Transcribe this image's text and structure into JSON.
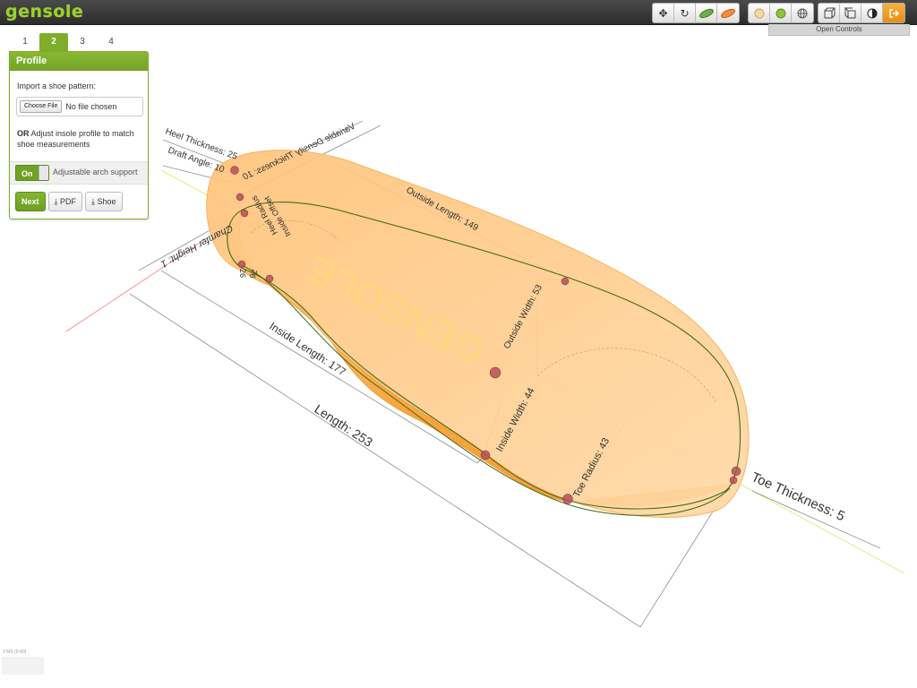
{
  "app": {
    "logo": "gensole"
  },
  "toolbar": {
    "groups": [
      {
        "name": "view-tools",
        "icons": [
          "move-icon",
          "rotate-icon",
          "insole-green-icon",
          "insole-orange-icon"
        ]
      },
      {
        "name": "material-tools",
        "icons": [
          "beige-sphere-icon",
          "green-sphere-icon",
          "wireframe-globe-icon"
        ]
      },
      {
        "name": "camera-tools",
        "icons": [
          "cube-front-icon",
          "cube-side-icon",
          "contrast-icon",
          "exit-icon"
        ]
      }
    ],
    "open_controls": "Open Controls"
  },
  "tabs": [
    "1",
    "2",
    "3",
    "4"
  ],
  "active_tab": "2",
  "panel": {
    "title": "Profile",
    "import_label": "Import a shoe pattern:",
    "file_button": "Choose File",
    "file_status": "No file chosen",
    "or_prefix": "OR",
    "adjust_text": "Adjust insole profile to match shoe measurements",
    "toggle_label": "On",
    "arch_support": "Adjustable arch support",
    "next": "Next",
    "pdf": "PDF",
    "shoe": "Shoe"
  },
  "status": "2 MS (0-60)",
  "insole_logo": "GENSOLE",
  "measurements": {
    "heel_thickness": "Heel Thickness: 25",
    "draft_angle": "Draft Angle: 10",
    "variable_density": "Variable Density Thickness: 10",
    "chamfer_height": "Chamfer Height: 1",
    "heel_radius": "Heel Radius",
    "heel_radius_value": "26",
    "inside_offset": "Inside Offset",
    "inside_offset_value": "26",
    "outside_length": "Outside Length: 149",
    "outside_width": "Outside Width: 53",
    "inside_length": "Inside Length: 177",
    "length": "Length: 253",
    "inside_width": "Inside Width: 44",
    "toe_radius": "Toe Radius: 43",
    "toe_thickness": "Toe Thickness: 5"
  },
  "colors": {
    "accent_green": "#7fae2a",
    "insole_fill": "#ffc982",
    "insole_edge": "#f5a23c",
    "outline_green": "#4a6a12",
    "handle": "#b5505a"
  }
}
